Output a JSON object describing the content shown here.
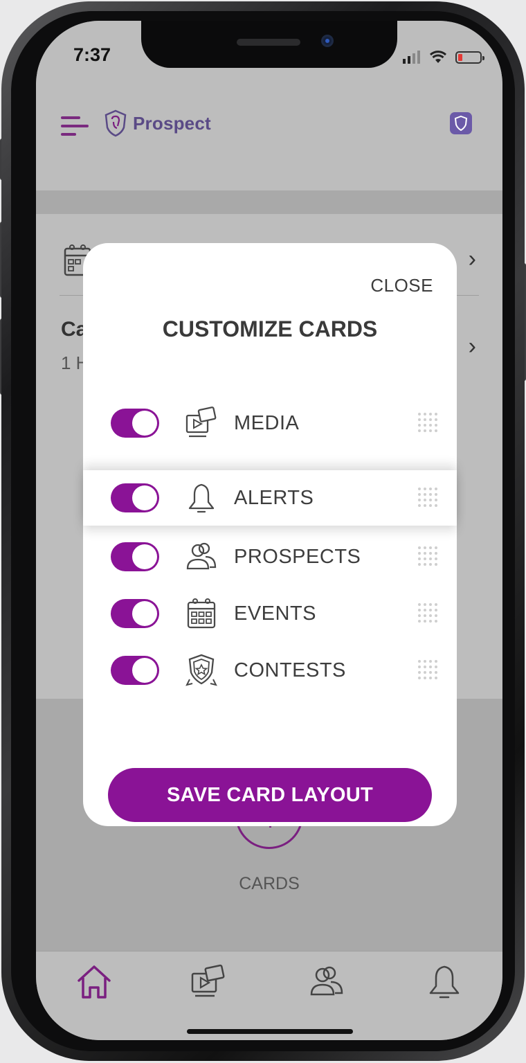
{
  "status_bar": {
    "time": "7:37"
  },
  "header": {
    "brand": "Prospect",
    "menu_icon": "hamburger-icon",
    "badge_icon": "shield-logo-icon"
  },
  "background": {
    "title_partial": "Ca",
    "subtitle_partial": "1 H",
    "cards_label": "CARDS"
  },
  "modal": {
    "close_label": "CLOSE",
    "title": "CUSTOMIZE CARDS",
    "items": [
      {
        "label": "MEDIA",
        "icon": "media-icon",
        "enabled": true
      },
      {
        "label": "ALERTS",
        "icon": "bell-icon",
        "enabled": true
      },
      {
        "label": "PROSPECTS",
        "icon": "people-icon",
        "enabled": true
      },
      {
        "label": "EVENTS",
        "icon": "calendar-icon",
        "enabled": true
      },
      {
        "label": "CONTESTS",
        "icon": "badge-icon",
        "enabled": true
      }
    ],
    "save_label": "SAVE CARD LAYOUT"
  },
  "bottom_nav": {
    "items": [
      "home-icon",
      "media-icon",
      "people-icon",
      "bell-icon"
    ]
  },
  "colors": {
    "accent": "#8a1396",
    "overlay": "#bdbdbd",
    "text": "#3d3d3d"
  }
}
